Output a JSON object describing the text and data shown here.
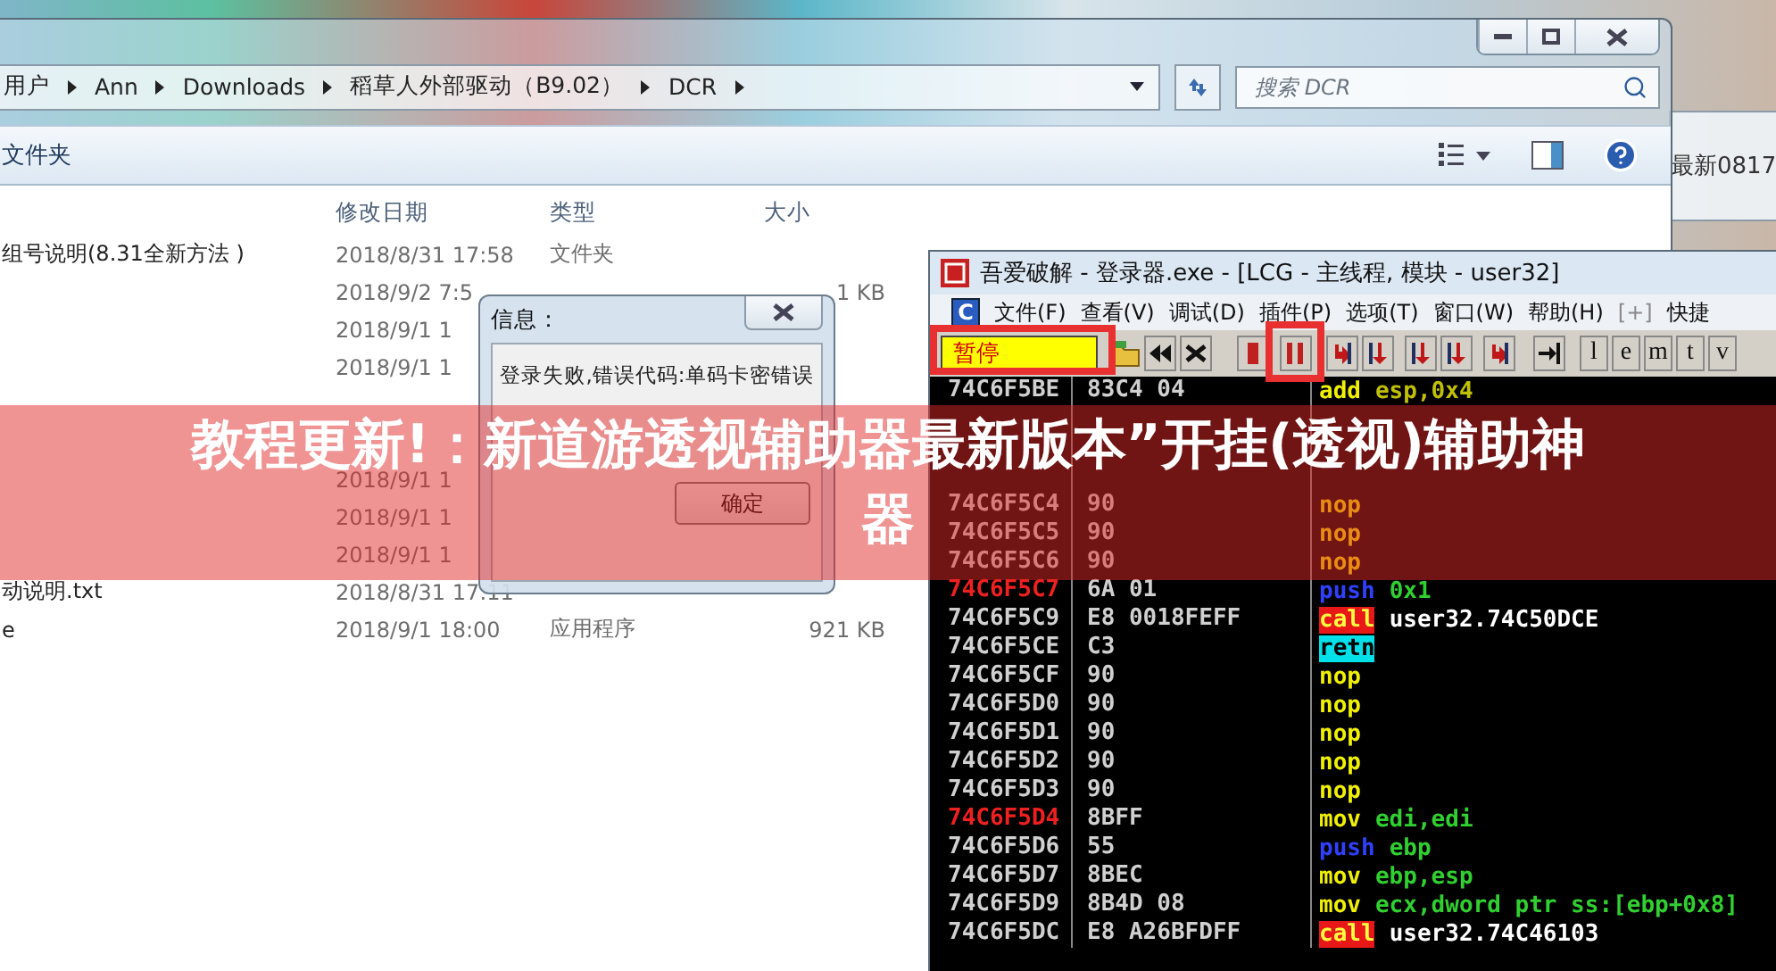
{
  "explorer": {
    "breadcrumb": [
      "用户",
      "Ann",
      "Downloads",
      "稻草人外部驱动（B9.02）",
      "DCR"
    ],
    "search": {
      "placeholder": "搜索 DCR"
    },
    "toolbar_label": "文件夹",
    "columns": [
      "修改日期",
      "类型",
      "大小"
    ],
    "rows": [
      {
        "name": "组号说明(8.31全新方法 )",
        "date": "2018/8/31 17:58",
        "type": "文件夹"
      },
      {
        "date": "2018/9/2 7:5",
        "size": "1 KB"
      },
      {
        "date": "2018/9/1 1"
      },
      {
        "date": "2018/9/1 1"
      },
      {},
      {},
      {
        "date": "2018/9/1 1"
      },
      {
        "date": "2018/9/1 1"
      },
      {
        "date": "2018/9/1 1"
      },
      {
        "name": "动说明.txt",
        "date": "2018/8/31 17:11"
      },
      {
        "name": "e",
        "date": "2018/9/1 18:00",
        "type": "应用程序",
        "size": "921 KB"
      }
    ]
  },
  "dialog": {
    "title": "信息：",
    "message": "登录失败,错误代码:单码卡密错误",
    "button": "确定"
  },
  "side_window": {
    "text": "最新0817"
  },
  "debugger": {
    "title": "吾爱破解 - 登录器.exe - [LCG -  主线程, 模块 - user32]",
    "logo_letter": "C",
    "menu": [
      {
        "label": "文件(F)",
        "dimmed": false
      },
      {
        "label": "查看(V)",
        "dimmed": false
      },
      {
        "label": "调试(D)",
        "dimmed": false
      },
      {
        "label": "插件(P)",
        "dimmed": false
      },
      {
        "label": "选项(T)",
        "dimmed": false
      },
      {
        "label": "窗口(W)",
        "dimmed": false
      },
      {
        "label": "帮助(H)",
        "dimmed": false
      },
      {
        "label": "[+]",
        "dimmed": true
      },
      {
        "label": "快捷",
        "dimmed": false
      }
    ],
    "status": "暂停",
    "letter_buttons": [
      "l",
      "e",
      "m",
      "t",
      "v"
    ],
    "rows": [
      {
        "address": "74C6F5BE",
        "hex": "83C4 04",
        "mnemonic": "add",
        "operands": "esp,0x4",
        "kind": "add",
        "marked": false
      },
      {
        "kind": "blank"
      },
      {
        "kind": "blank"
      },
      {
        "kind": "blank"
      },
      {
        "address": "74C6F5C4",
        "hex": "90",
        "mnemonic": "nop",
        "kind": "nop",
        "marked": false
      },
      {
        "address": "74C6F5C5",
        "hex": "90",
        "mnemonic": "nop",
        "kind": "nop",
        "marked": false
      },
      {
        "address": "74C6F5C6",
        "hex": "90",
        "mnemonic": "nop",
        "kind": "nop",
        "marked": false
      },
      {
        "address": "74C6F5C7",
        "hex": "6A 01",
        "mnemonic": "push",
        "operands": "0x1",
        "kind": "push",
        "marked": true
      },
      {
        "address": "74C6F5C9",
        "hex": "E8 0018FEFF",
        "mnemonic": "call",
        "operands": "user32.74C50DCE",
        "kind": "call",
        "marked": false
      },
      {
        "address": "74C6F5CE",
        "hex": "C3",
        "mnemonic": "retn",
        "kind": "retn",
        "marked": false
      },
      {
        "address": "74C6F5CF",
        "hex": "90",
        "mnemonic": "nop",
        "kind": "nop",
        "marked": false
      },
      {
        "address": "74C6F5D0",
        "hex": "90",
        "mnemonic": "nop",
        "kind": "nop",
        "marked": false
      },
      {
        "address": "74C6F5D1",
        "hex": "90",
        "mnemonic": "nop",
        "kind": "nop",
        "marked": false
      },
      {
        "address": "74C6F5D2",
        "hex": "90",
        "mnemonic": "nop",
        "kind": "nop",
        "marked": false
      },
      {
        "address": "74C6F5D3",
        "hex": "90",
        "mnemonic": "nop",
        "kind": "nop",
        "marked": false
      },
      {
        "address": "74C6F5D4",
        "hex": "8BFF",
        "mnemonic": "mov",
        "operands": "edi,edi",
        "kind": "mov",
        "marked": true
      },
      {
        "address": "74C6F5D6",
        "hex": "55",
        "mnemonic": "push",
        "operands": "ebp",
        "kind": "push",
        "marked": false
      },
      {
        "address": "74C6F5D7",
        "hex": "8BEC",
        "mnemonic": "mov",
        "operands": "ebp,esp",
        "kind": "mov",
        "marked": false
      },
      {
        "address": "74C6F5D9",
        "hex": "8B4D 08",
        "mnemonic": "mov",
        "operands": "ecx,dword ptr ss:[ebp+0x8]",
        "kind": "mov",
        "marked": false
      },
      {
        "address": "74C6F5DC",
        "hex": "E8 A26BFDFF",
        "mnemonic": "call",
        "operands": "user32.74C46103",
        "kind": "call",
        "marked": false
      }
    ]
  },
  "banner": {
    "lines": [
      "教程更新!：新道游透视辅助器最新版本”开挂(透视)辅助神",
      "器"
    ]
  }
}
